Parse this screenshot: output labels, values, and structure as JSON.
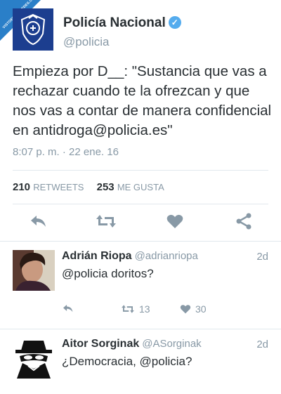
{
  "watermark": "VISTOENLASREDES.COM",
  "account": {
    "name": "Policía Nacional",
    "handle": "@policia",
    "verified": true
  },
  "tweet": {
    "text": "Empieza por D__: \"Sustancia que vas a rechazar cuando te la ofrezcan y que nos vas a contar de manera confidencial en antidroga@policia.es\"",
    "timestamp": "8:07 p. m. · 22 ene. 16",
    "retweets": "210",
    "retweets_label": "RETWEETS",
    "likes": "253",
    "likes_label": "ME GUSTA"
  },
  "actions": [
    "reply-icon",
    "retweet-icon",
    "heart-icon",
    "share-icon"
  ],
  "replies": [
    {
      "name": "Adrián Riopa",
      "handle": "@adrianriopa",
      "time": "2d",
      "text": "@policia doritos?",
      "retweets": "13",
      "likes": "30"
    },
    {
      "name": "Aitor Sorginak",
      "handle": "@ASorginak",
      "time": "2d",
      "text": "¿Democracia, @policia?"
    }
  ],
  "colors": {
    "brand_blue": "#1c3e8f",
    "verified": "#55acee",
    "muted": "#8899a6",
    "text": "#292f33",
    "divider": "#e1e8ed"
  }
}
